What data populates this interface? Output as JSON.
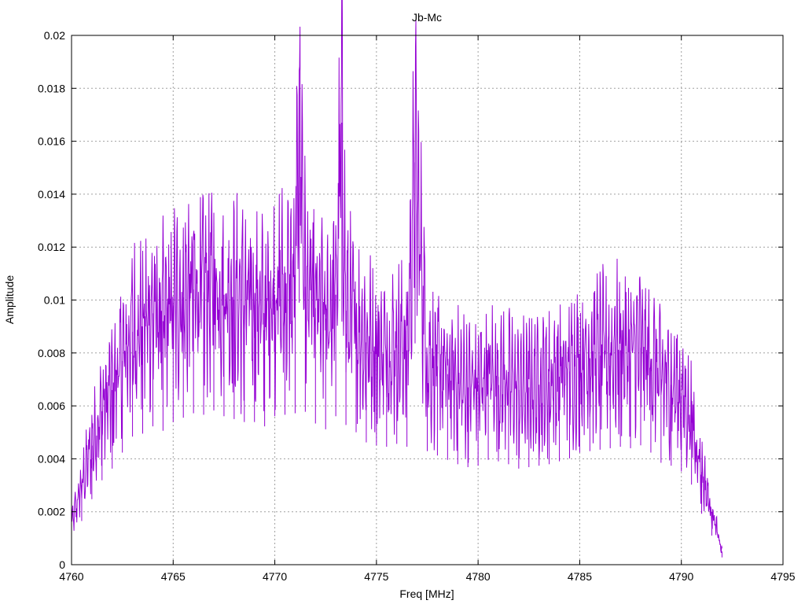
{
  "chart_data": {
    "type": "line",
    "title": "Jb-Mc",
    "xlabel": "Freq [MHz]",
    "ylabel": "Amplitude",
    "xlim": [
      4760,
      4795
    ],
    "ylim": [
      0,
      0.02
    ],
    "xticks": [
      "4760",
      "4765",
      "4770",
      "4775",
      "4780",
      "4785",
      "4790",
      "4795"
    ],
    "yticks": [
      "0",
      "0.002",
      "0.004",
      "0.006",
      "0.008",
      "0.01",
      "0.012",
      "0.014",
      "0.016",
      "0.018",
      "0.02"
    ],
    "grid": true,
    "legend": "none",
    "series": [
      {
        "color": "#9400d3",
        "x": [
          4760.0,
          4760.5,
          4761.0,
          4761.5,
          4762.0,
          4762.5,
          4763.0,
          4763.5,
          4764.0,
          4764.5,
          4765.0,
          4765.5,
          4766.0,
          4766.5,
          4767.0,
          4767.5,
          4768.0,
          4768.5,
          4769.0,
          4769.5,
          4770.0,
          4770.5,
          4771.0,
          4771.2,
          4771.5,
          4772.0,
          4772.5,
          4773.0,
          4773.3,
          4773.5,
          4774.0,
          4774.5,
          4775.0,
          4775.5,
          4776.0,
          4776.5,
          4776.9,
          4777.5,
          4778.0,
          4778.5,
          4779.0,
          4779.5,
          4780.0,
          4780.5,
          4781.0,
          4781.5,
          4782.0,
          4782.5,
          4783.0,
          4783.5,
          4784.0,
          4784.5,
          4785.0,
          4785.5,
          4786.0,
          4786.5,
          4787.0,
          4787.5,
          4788.0,
          4788.5,
          4789.0,
          4789.5,
          4790.0,
          4790.5,
          4791.0,
          4791.5,
          4792.0
        ],
        "y": [
          0.0015,
          0.003,
          0.0045,
          0.0058,
          0.0066,
          0.0077,
          0.0088,
          0.009,
          0.0095,
          0.0092,
          0.0098,
          0.0101,
          0.0104,
          0.0103,
          0.0106,
          0.0102,
          0.01,
          0.0098,
          0.0098,
          0.0095,
          0.0102,
          0.0103,
          0.0104,
          0.018,
          0.0105,
          0.0097,
          0.0093,
          0.0102,
          0.0167,
          0.0096,
          0.0091,
          0.0084,
          0.0082,
          0.0081,
          0.0083,
          0.0081,
          0.0152,
          0.0078,
          0.0075,
          0.0072,
          0.0069,
          0.0067,
          0.0068,
          0.0072,
          0.0071,
          0.0069,
          0.0066,
          0.0067,
          0.0068,
          0.0069,
          0.0071,
          0.0073,
          0.0077,
          0.0078,
          0.0079,
          0.008,
          0.0081,
          0.008,
          0.0082,
          0.0077,
          0.007,
          0.0068,
          0.0064,
          0.0055,
          0.0035,
          0.002,
          0.0005
        ]
      }
    ]
  }
}
